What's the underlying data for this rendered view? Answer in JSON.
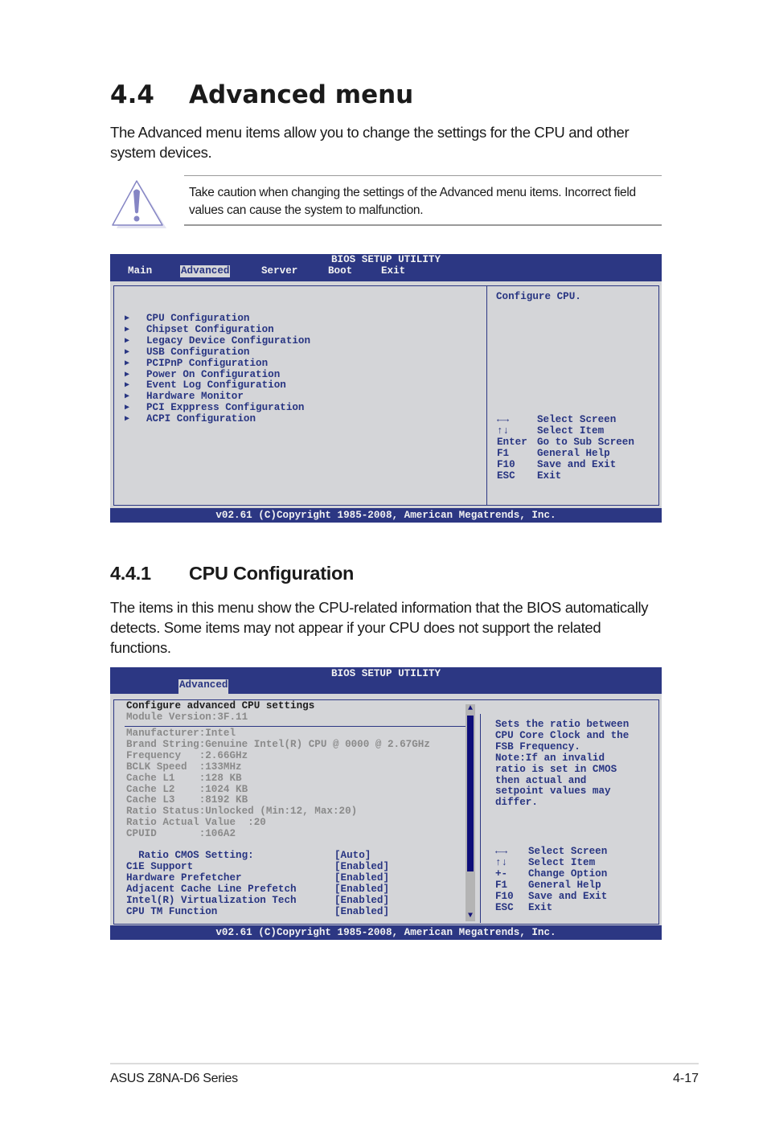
{
  "section": {
    "number": "4.4",
    "title": "Advanced menu",
    "intro": "The Advanced menu items allow you to change the settings for the CPU and other system devices.",
    "caution_icon": "warning-triangle-icon",
    "caution": "Take caution when changing the settings of the Advanced menu items. Incorrect field values can cause the system to malfunction."
  },
  "bios1": {
    "title": "BIOS SETUP UTILITY",
    "tabs": [
      {
        "label": "Main",
        "active": false
      },
      {
        "label": "Advanced",
        "active": true
      },
      {
        "label": "Server",
        "active": false
      },
      {
        "label": "Boot",
        "active": false
      },
      {
        "label": "Exit",
        "active": false
      }
    ],
    "menu_icon": "triangle-right-icon",
    "menu_items": [
      "CPU Configuration",
      "Chipset Configuration",
      "Legacy Device Configuration",
      "USB Configuration",
      "PCIPnP Configuration",
      "Power On Configuration",
      "Event Log Configuration",
      "Hardware Monitor",
      "PCI Exppress Configuration",
      "ACPI Configuration"
    ],
    "help": "Configure CPU.",
    "keys": [
      {
        "key": "←→",
        "action": "Select Screen"
      },
      {
        "key": "↑↓",
        "action": "Select Item"
      },
      {
        "key": "Enter",
        "action": "Go to Sub Screen"
      },
      {
        "key": "F1",
        "action": "General Help"
      },
      {
        "key": "F10",
        "action": "Save and Exit"
      },
      {
        "key": "ESC",
        "action": "Exit"
      }
    ],
    "footer": "v02.61 (C)Copyright 1985-2008, American Megatrends, Inc."
  },
  "subsection": {
    "number": "4.4.1",
    "title": "CPU Configuration",
    "intro": "The items in this menu show the CPU-related information that the BIOS automatically detects. Some items may not appear if your CPU does not support the related functions."
  },
  "bios2": {
    "title": "BIOS SETUP UTILITY",
    "active_tab": "Advanced",
    "heading": "Configure advanced CPU settings",
    "module_version": "Module Version:3F.11",
    "info": [
      "Manufacturer:Intel",
      "Brand String:Genuine Intel(R) CPU @ 0000 @ 2.67GHz",
      "Frequency   :2.66GHz",
      "BCLK Speed  :133MHz",
      "Cache L1    :128 KB",
      "Cache L2    :1024 KB",
      "Cache L3    :8192 KB",
      "Ratio Status:Unlocked (Min:12, Max:20)",
      "Ratio Actual Value  :20",
      "CPUID       :106A2"
    ],
    "settings": [
      {
        "label": "  Ratio CMOS Setting:",
        "value": "[Auto]"
      },
      {
        "label": "C1E Support",
        "value": "[Enabled]"
      },
      {
        "label": "Hardware Prefetcher",
        "value": "[Enabled]"
      },
      {
        "label": "Adjacent Cache Line Prefetch",
        "value": "[Enabled]"
      },
      {
        "label": "Intel(R) Virtualization Tech",
        "value": "[Enabled]"
      },
      {
        "label": "CPU TM Function",
        "value": "[Enabled]"
      }
    ],
    "scroll_position_fraction": 0.8,
    "help": [
      "Sets the ratio between",
      "CPU Core Clock and the",
      "FSB Frequency.",
      "Note:If an invalid",
      "ratio is set in CMOS",
      "then actual and",
      "setpoint values may",
      "differ."
    ],
    "keys": [
      {
        "key": "←→",
        "action": "Select Screen"
      },
      {
        "key": "↑↓",
        "action": "Select Item"
      },
      {
        "key": "+-",
        "action": "Change Option"
      },
      {
        "key": "F1",
        "action": "General Help"
      },
      {
        "key": "F10",
        "action": "Save and Exit"
      },
      {
        "key": "ESC",
        "action": "Exit"
      }
    ],
    "footer": "v02.61 (C)Copyright 1985-2008, American Megatrends, Inc."
  },
  "page_footer": {
    "product": "ASUS Z8NA-D6 Series",
    "page": "4-17"
  },
  "colors": {
    "bios_blue": "#2c3783",
    "bios_gray": "#d4d5d8",
    "scroll_thumb": "#0e0e7a",
    "caution_purple": "#8585c4"
  }
}
